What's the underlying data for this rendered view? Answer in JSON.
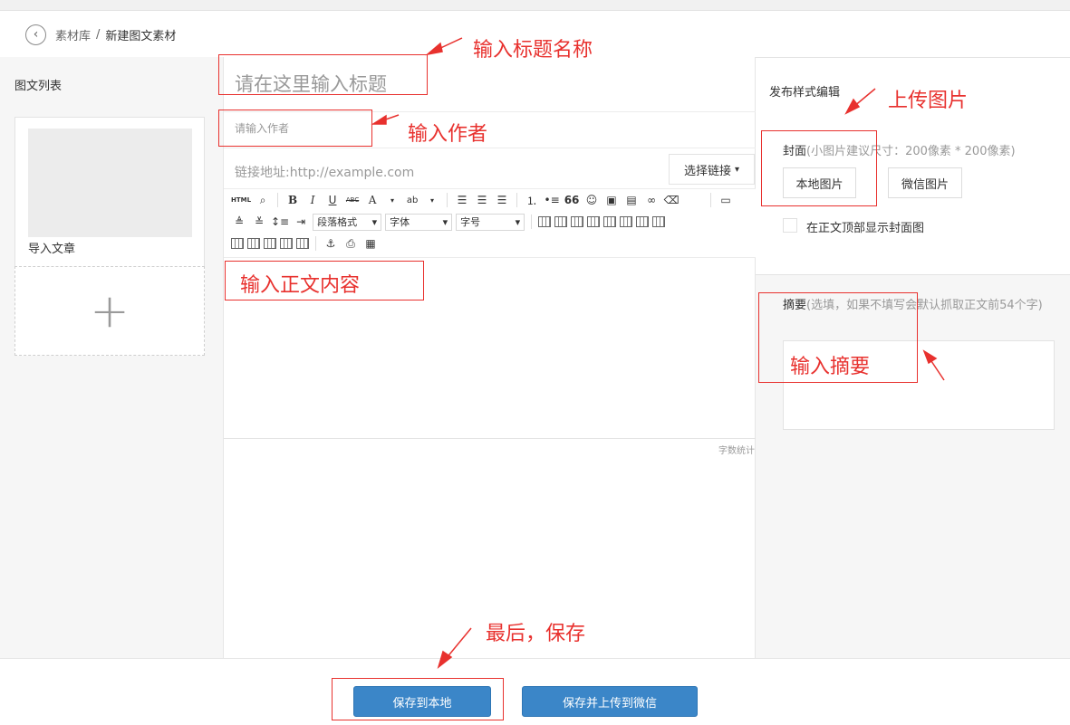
{
  "breadcrumb": {
    "back_icon": "chevron-left-icon",
    "parent": "素材库",
    "separator": "/",
    "current": "新建图文素材"
  },
  "left": {
    "title": "图文列表",
    "article_label": "导入文章",
    "add_symbol": "+"
  },
  "editor": {
    "title_placeholder": "请在这里输入标题",
    "author_placeholder": "请输入作者",
    "link_placeholder": "链接地址:http://example.com",
    "select_link": "选择链接",
    "paragraph_format": "段落格式",
    "font": "字体",
    "font_size": "字号",
    "word_count": "字数统计",
    "toolbar_row1": [
      "HTML",
      "B",
      "I",
      "U",
      "ABC",
      "A",
      "ab",
      "66",
      "☺"
    ],
    "dropdown_caret": "▾"
  },
  "right": {
    "title": "发布样式编辑",
    "cover_label": "封面",
    "cover_hint": "(小图片建议尺寸：200像素 * 200像素)",
    "local_image": "本地图片",
    "wechat_image": "微信图片",
    "show_cover_label": "在正文顶部显示封面图",
    "summary_label": "摘要",
    "summary_hint": "(选填，如果不填写会默认抓取正文前54个字)"
  },
  "buttons": {
    "save_local": "保存到本地",
    "save_upload": "保存并上传到微信"
  },
  "annotations": {
    "title": "输入标题名称",
    "author": "输入作者",
    "body": "输入正文内容",
    "upload": "上传图片",
    "summary": "输入摘要",
    "save": "最后，保存",
    "color": "#e8312e"
  }
}
